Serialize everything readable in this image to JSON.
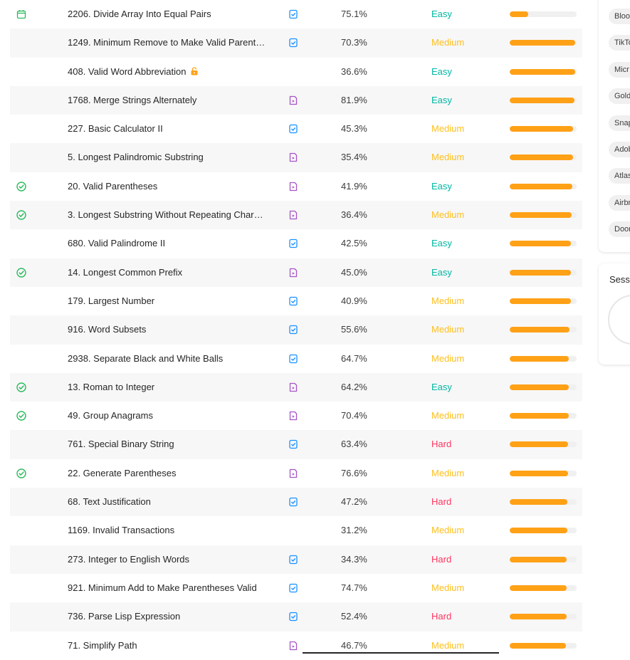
{
  "colors": {
    "easy": "#00b8a3",
    "medium": "#ffc01e",
    "hard": "#ff375f",
    "progress": "#ffa116",
    "track": "#f0f0f0",
    "solved_check": "#2cbb5d",
    "video_solution": "#a855c7",
    "article_solution": "#1a90ff"
  },
  "problems": [
    {
      "status": "calendar-icon",
      "title": "2206. Divide Array Into Equal Pairs",
      "locked": false,
      "solution": "article",
      "acceptance": "75.1%",
      "difficulty": "Easy",
      "frequency": 0.28
    },
    {
      "status": "",
      "title": "1249. Minimum Remove to Make Valid Parent…",
      "locked": false,
      "solution": "article",
      "acceptance": "70.3%",
      "difficulty": "Medium",
      "frequency": 0.98
    },
    {
      "status": "",
      "title": "408. Valid Word Abbreviation",
      "locked": true,
      "solution": "",
      "acceptance": "36.6%",
      "difficulty": "Easy",
      "frequency": 0.98
    },
    {
      "status": "",
      "title": "1768. Merge Strings Alternately",
      "locked": false,
      "solution": "video",
      "acceptance": "81.9%",
      "difficulty": "Easy",
      "frequency": 0.97
    },
    {
      "status": "",
      "title": "227. Basic Calculator II",
      "locked": false,
      "solution": "article",
      "acceptance": "45.3%",
      "difficulty": "Medium",
      "frequency": 0.95
    },
    {
      "status": "",
      "title": "5. Longest Palindromic Substring",
      "locked": false,
      "solution": "video",
      "acceptance": "35.4%",
      "difficulty": "Medium",
      "frequency": 0.95
    },
    {
      "status": "solved",
      "title": "20. Valid Parentheses",
      "locked": false,
      "solution": "video",
      "acceptance": "41.9%",
      "difficulty": "Easy",
      "frequency": 0.94
    },
    {
      "status": "solved",
      "title": "3. Longest Substring Without Repeating Char…",
      "locked": false,
      "solution": "video",
      "acceptance": "36.4%",
      "difficulty": "Medium",
      "frequency": 0.93
    },
    {
      "status": "",
      "title": "680. Valid Palindrome II",
      "locked": false,
      "solution": "article",
      "acceptance": "42.5%",
      "difficulty": "Easy",
      "frequency": 0.92
    },
    {
      "status": "solved",
      "title": "14. Longest Common Prefix",
      "locked": false,
      "solution": "video",
      "acceptance": "45.0%",
      "difficulty": "Easy",
      "frequency": 0.91
    },
    {
      "status": "",
      "title": "179. Largest Number",
      "locked": false,
      "solution": "article",
      "acceptance": "40.9%",
      "difficulty": "Medium",
      "frequency": 0.91
    },
    {
      "status": "",
      "title": "916. Word Subsets",
      "locked": false,
      "solution": "article",
      "acceptance": "55.6%",
      "difficulty": "Medium",
      "frequency": 0.89
    },
    {
      "status": "",
      "title": "2938. Separate Black and White Balls",
      "locked": false,
      "solution": "article",
      "acceptance": "64.7%",
      "difficulty": "Medium",
      "frequency": 0.88
    },
    {
      "status": "solved",
      "title": "13. Roman to Integer",
      "locked": false,
      "solution": "video",
      "acceptance": "64.2%",
      "difficulty": "Easy",
      "frequency": 0.88
    },
    {
      "status": "solved",
      "title": "49. Group Anagrams",
      "locked": false,
      "solution": "video",
      "acceptance": "70.4%",
      "difficulty": "Medium",
      "frequency": 0.88
    },
    {
      "status": "",
      "title": "761. Special Binary String",
      "locked": false,
      "solution": "article",
      "acceptance": "63.4%",
      "difficulty": "Hard",
      "frequency": 0.87
    },
    {
      "status": "solved",
      "title": "22. Generate Parentheses",
      "locked": false,
      "solution": "video",
      "acceptance": "76.6%",
      "difficulty": "Medium",
      "frequency": 0.87
    },
    {
      "status": "",
      "title": "68. Text Justification",
      "locked": false,
      "solution": "article",
      "acceptance": "47.2%",
      "difficulty": "Hard",
      "frequency": 0.86
    },
    {
      "status": "",
      "title": "1169. Invalid Transactions",
      "locked": false,
      "solution": "",
      "acceptance": "31.2%",
      "difficulty": "Medium",
      "frequency": 0.86
    },
    {
      "status": "",
      "title": "273. Integer to English Words",
      "locked": false,
      "solution": "article",
      "acceptance": "34.3%",
      "difficulty": "Hard",
      "frequency": 0.85
    },
    {
      "status": "",
      "title": "921. Minimum Add to Make Parentheses Valid",
      "locked": false,
      "solution": "article",
      "acceptance": "74.7%",
      "difficulty": "Medium",
      "frequency": 0.85
    },
    {
      "status": "",
      "title": "736. Parse Lisp Expression",
      "locked": false,
      "solution": "article",
      "acceptance": "52.4%",
      "difficulty": "Hard",
      "frequency": 0.85
    },
    {
      "status": "",
      "title": "71. Simplify Path",
      "locked": false,
      "solution": "video",
      "acceptance": "46.7%",
      "difficulty": "Medium",
      "frequency": 0.84
    }
  ],
  "company_tags": [
    "Bloo",
    "TikTo",
    "Micr",
    "Gold",
    "Snap",
    "Adob",
    "Atlas",
    "Airbn",
    "Door"
  ],
  "session": {
    "label": "Sess"
  }
}
